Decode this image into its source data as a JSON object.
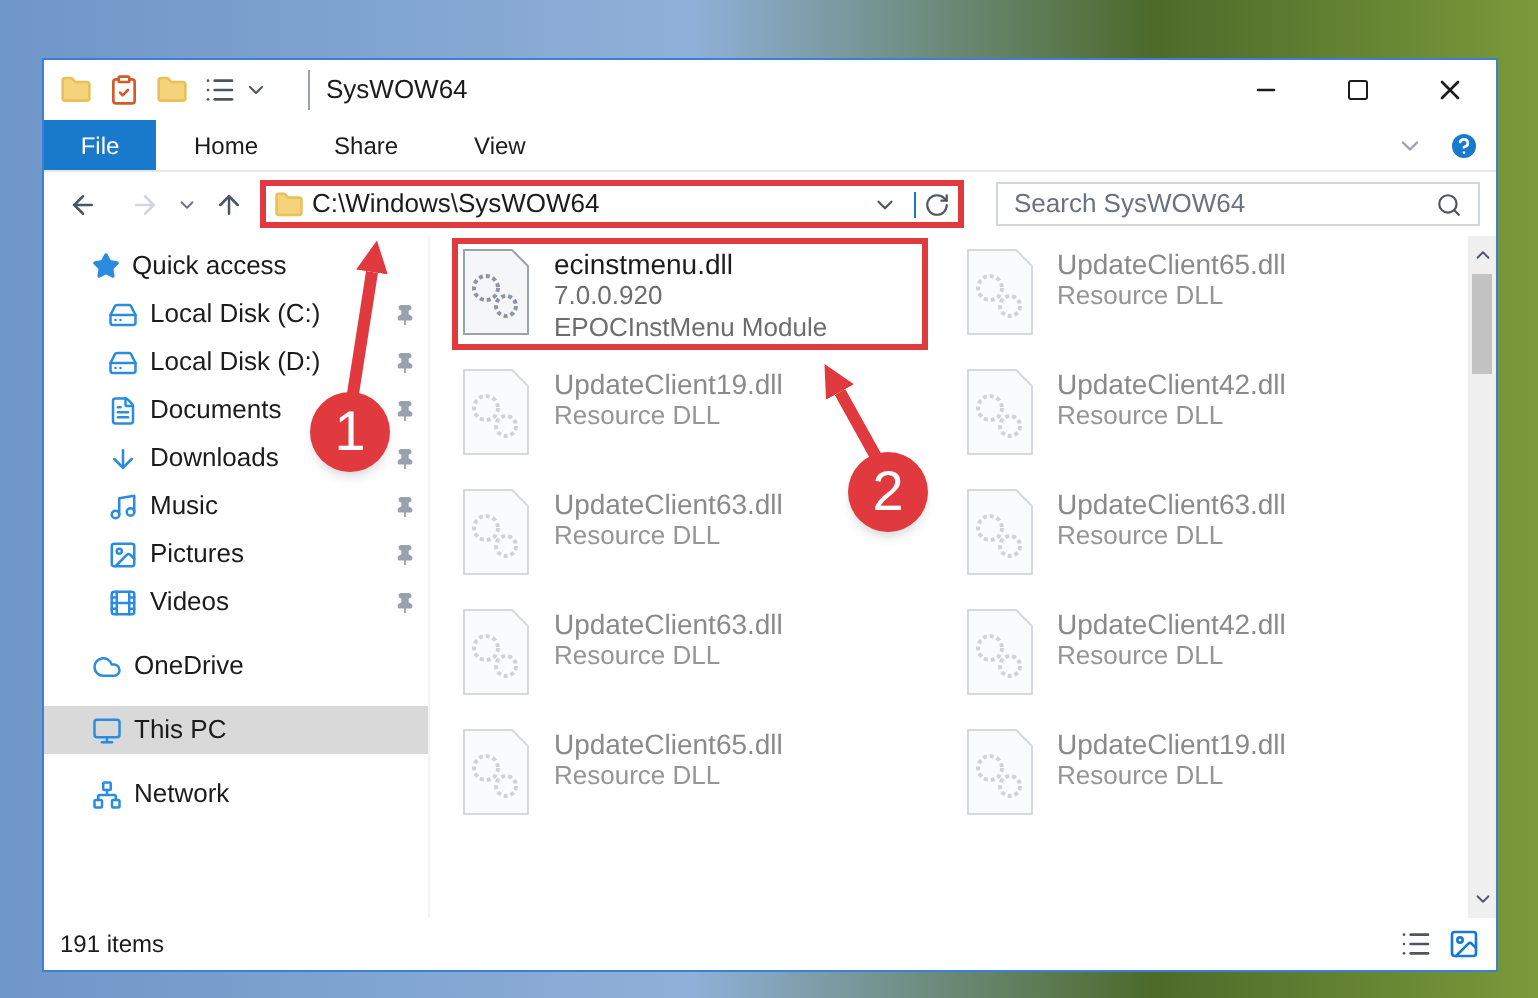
{
  "window": {
    "title": "SysWOW64"
  },
  "ribbon": {
    "tabs": [
      {
        "label": "File",
        "selected": true
      },
      {
        "label": "Home",
        "selected": false
      },
      {
        "label": "Share",
        "selected": false
      },
      {
        "label": "View",
        "selected": false
      }
    ]
  },
  "address_bar": {
    "path": "C:\\Windows\\SysWOW64",
    "highlighted": true
  },
  "search": {
    "placeholder": "Search SysWOW64"
  },
  "sidebar": {
    "items": [
      {
        "label": "Quick access",
        "selected": false,
        "children": [
          {
            "label": "Local Disk (C:)",
            "pinned": true,
            "selected": false
          },
          {
            "label": "Local Disk (D:)",
            "pinned": true,
            "selected": false
          },
          {
            "label": "Documents",
            "pinned": true,
            "selected": false
          },
          {
            "label": "Downloads",
            "pinned": true,
            "selected": false
          },
          {
            "label": "Music",
            "pinned": true,
            "selected": false
          },
          {
            "label": "Pictures",
            "pinned": true,
            "selected": false
          },
          {
            "label": "Videos",
            "pinned": true,
            "selected": false
          }
        ]
      },
      {
        "label": "OneDrive",
        "selected": false
      },
      {
        "label": "This PC",
        "selected": true
      },
      {
        "label": "Network",
        "selected": false
      }
    ]
  },
  "files": [
    {
      "name": "ecinstmenu.dll",
      "details": [
        "7.0.0.920",
        "EPOCInstMenu Module"
      ],
      "highlighted": true,
      "blurred": false
    },
    {
      "name": "UpdateClient65.dll",
      "details": [
        "Resource DLL"
      ],
      "highlighted": false,
      "blurred": true
    },
    {
      "name": "UpdateClient19.dll",
      "details": [
        "Resource DLL"
      ],
      "highlighted": false,
      "blurred": true
    },
    {
      "name": "UpdateClient42.dll",
      "details": [
        "Resource DLL"
      ],
      "highlighted": false,
      "blurred": true
    },
    {
      "name": "UpdateClient63.dll",
      "details": [
        "Resource DLL"
      ],
      "highlighted": false,
      "blurred": true
    },
    {
      "name": "UpdateClient63.dll",
      "details": [
        "Resource DLL"
      ],
      "highlighted": false,
      "blurred": true
    },
    {
      "name": "UpdateClient63.dll",
      "details": [
        "Resource DLL"
      ],
      "highlighted": false,
      "blurred": true
    },
    {
      "name": "UpdateClient42.dll",
      "details": [
        "Resource DLL"
      ],
      "highlighted": false,
      "blurred": true
    },
    {
      "name": "UpdateClient65.dll",
      "details": [
        "Resource DLL"
      ],
      "highlighted": false,
      "blurred": true
    },
    {
      "name": "UpdateClient19.dll",
      "details": [
        "Resource DLL"
      ],
      "highlighted": false,
      "blurred": true
    }
  ],
  "status_bar": {
    "item_count": "191 items"
  },
  "callouts": [
    {
      "number": "1"
    },
    {
      "number": "2"
    }
  ]
}
